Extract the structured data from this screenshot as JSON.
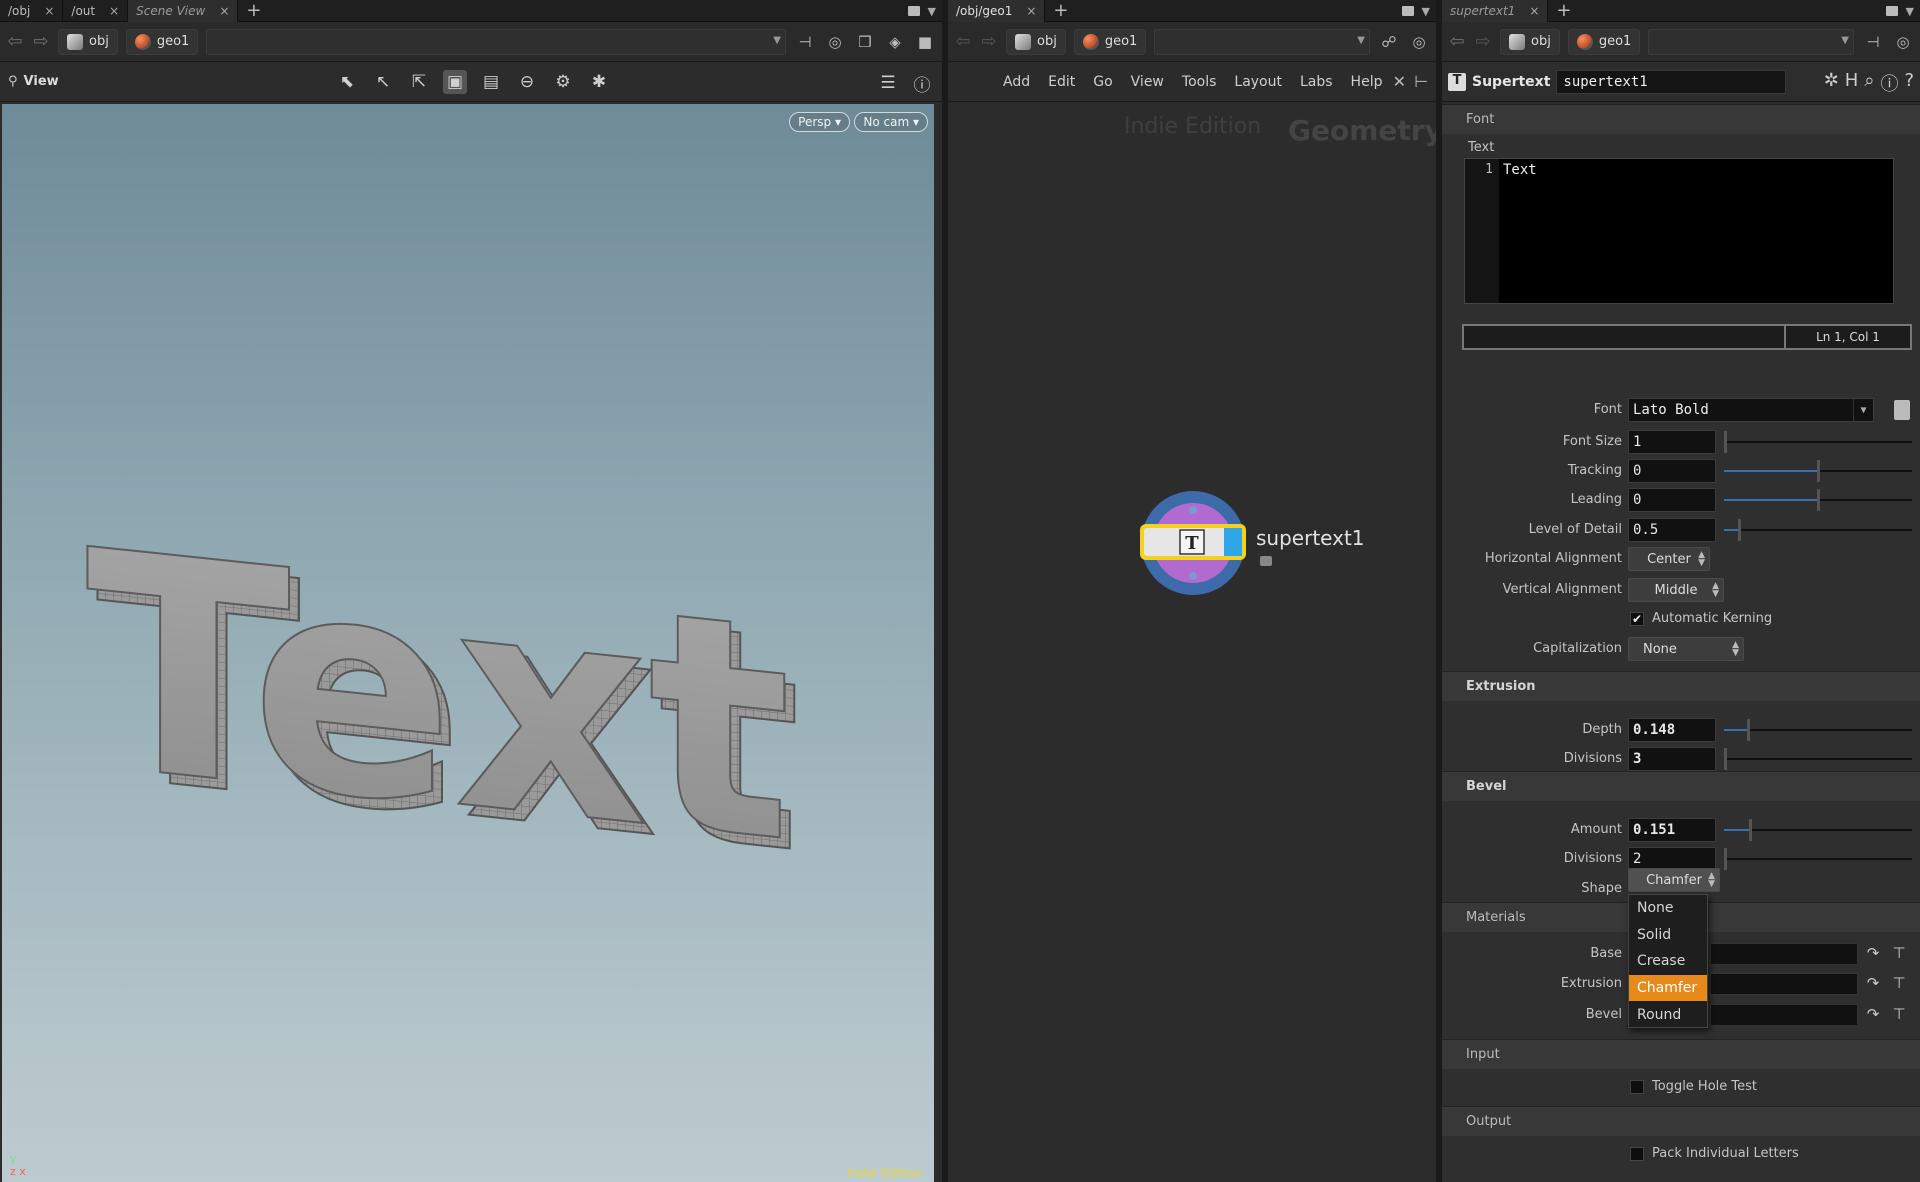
{
  "view_pane": {
    "tabs": [
      {
        "label": "/obj",
        "close": "×"
      },
      {
        "label": "/out",
        "close": "×"
      },
      {
        "label": "Scene View",
        "close": "×"
      }
    ],
    "path": {
      "obj": "obj",
      "geo": "geo1"
    },
    "toolbar_label": "View",
    "camera_menu": "Persp ▾",
    "cam_menu": "No cam ▾",
    "axis_y": "y",
    "axis_zx": "z x",
    "watermark": "Indie Edition",
    "model_text": "Text"
  },
  "network_pane": {
    "tabs": [
      {
        "label": "/obj/geo1",
        "close": "×"
      }
    ],
    "path": {
      "obj": "obj",
      "geo": "geo1"
    },
    "menus": [
      "Add",
      "Edit",
      "Go",
      "View",
      "Tools",
      "Layout",
      "Labs",
      "Help"
    ],
    "watermark_edition": "Indie Edition",
    "watermark_context": "Geometry",
    "node_name": "supertext1"
  },
  "parm_pane": {
    "tabs": [
      {
        "label": "supertext1",
        "close": "×"
      }
    ],
    "path": {
      "obj": "obj",
      "geo": "geo1"
    },
    "node_type": "Supertext",
    "node_name": "supertext1",
    "section_font": "Font",
    "text_label": "Text",
    "editor_line": "1",
    "editor_text": "Text",
    "cursor_pos": "Ln 1, Col 1",
    "font_label": "Font",
    "font_value": "Lato Bold",
    "font_size_label": "Font Size",
    "font_size": "1",
    "tracking_label": "Tracking",
    "tracking": "0",
    "leading_label": "Leading",
    "leading": "0",
    "lod_label": "Level of Detail",
    "lod": "0.5",
    "halign_label": "Horizontal Alignment",
    "halign": "Center",
    "valign_label": "Vertical Alignment",
    "valign": "Middle",
    "kerning_label": "Automatic Kerning",
    "kerning_check": "✔",
    "cap_label": "Capitalization",
    "cap": "None",
    "section_extrusion": "Extrusion",
    "depth_label": "Depth",
    "depth": "0.148",
    "ext_div_label": "Divisions",
    "ext_div": "3",
    "section_bevel": "Bevel",
    "amount_label": "Amount",
    "amount": "0.151",
    "bev_div_label": "Divisions",
    "bev_div": "2",
    "shape_label": "Shape",
    "shape": "Chamfer",
    "shape_options": [
      "None",
      "Solid",
      "Crease",
      "Chamfer",
      "Round"
    ],
    "section_materials": "Materials",
    "mat_base_label": "Base",
    "mat_extrusion_label": "Extrusion",
    "mat_bevel_label": "Bevel",
    "section_input": "Input",
    "hole_label": "Toggle Hole Test",
    "section_output": "Output",
    "pack_label": "Pack Individual Letters"
  },
  "sliders": {
    "font_size": 0.0,
    "tracking": 0.5,
    "leading": 0.5,
    "lod": 0.08,
    "depth": 0.13,
    "ext_div": 0.0,
    "amount": 0.14,
    "bev_div": 0.0
  },
  "colors": {
    "accent_orange": "#e8891c",
    "node_blue": "#2ea6e8",
    "node_yellow": "#f3d11f",
    "watermark_yellow": "#e8d43a"
  }
}
